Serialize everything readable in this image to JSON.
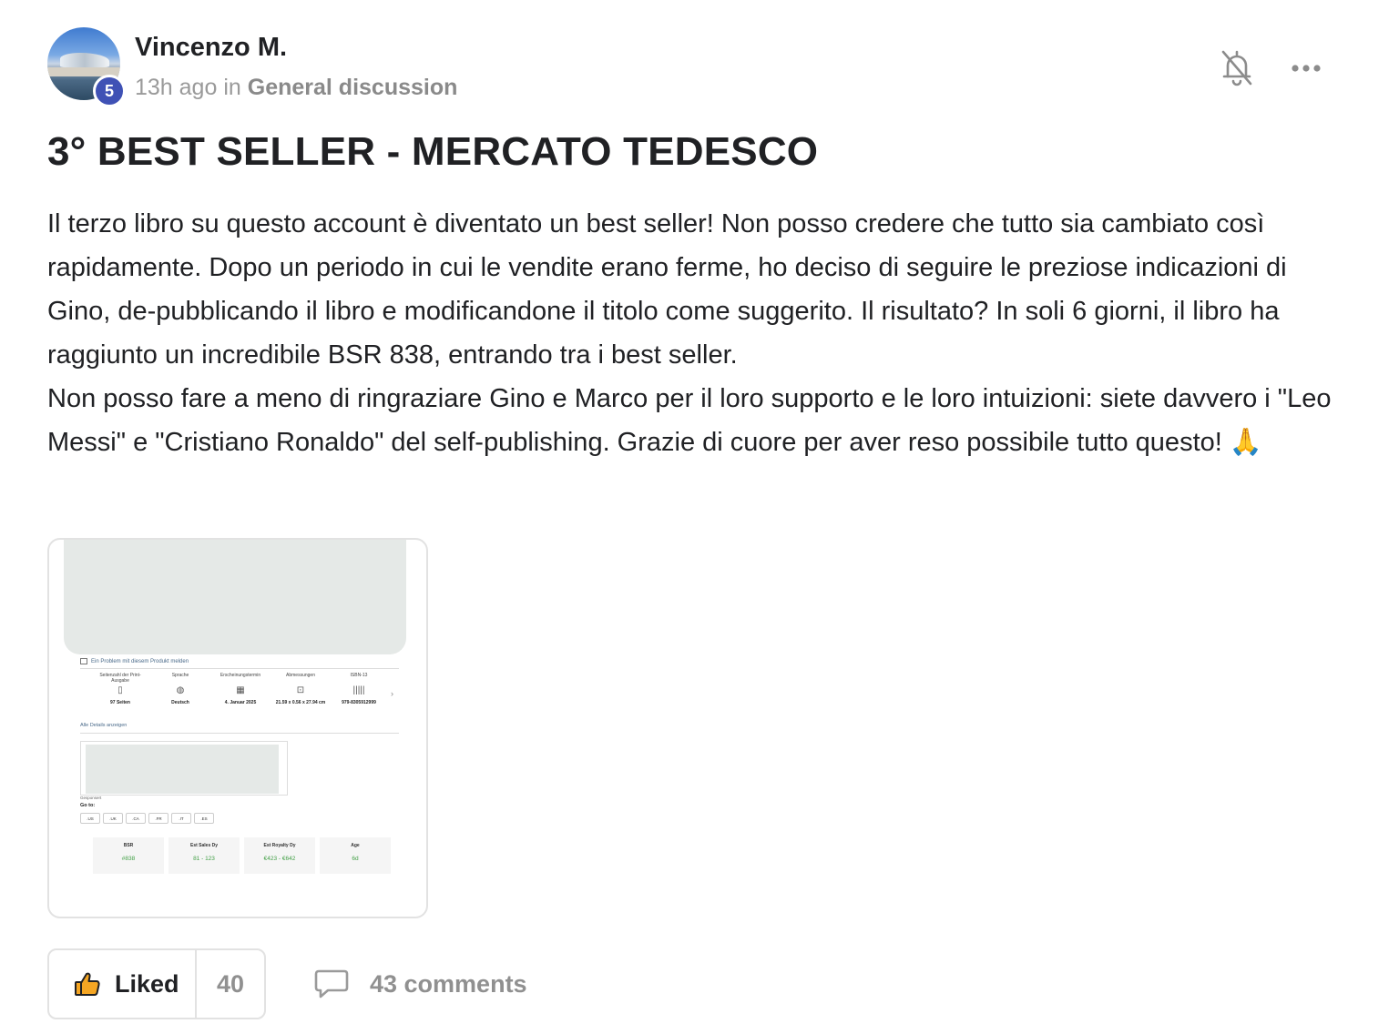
{
  "post": {
    "author": {
      "name": "Vincenzo M.",
      "level": "5",
      "avatar_icon": "avatar-photo"
    },
    "meta": {
      "time": "13h ago",
      "in_word": "in",
      "category": "General discussion"
    },
    "actions": {
      "notify_icon": "bell-off-icon",
      "more_icon": "ellipsis-icon"
    },
    "title": "3° BEST SELLER - MERCATO TEDESCO",
    "body": {
      "paragraph_1": "Il terzo libro su questo account è diventato un best seller! Non posso credere che tutto sia cambiato così rapidamente. Dopo un periodo in cui le vendite erano ferme, ho deciso di seguire le preziose indicazioni di Gino, de-pubblicando il libro e modificandone il titolo come suggerito. Il risultato? In soli 6 giorni, il libro ha raggiunto un incredibile BSR 838, entrando tra i best seller.",
      "paragraph_2": "Non posso fare a meno di ringraziare Gino e Marco per il loro supporto e le loro intuizioni: siete davvero i \"Leo Messi\" e \"Cristiano Ronaldo\" del self-publishing. Grazie di cuore per aver reso possibile tutto questo! 🙏"
    },
    "attachment": {
      "report_link": "Ein Problem mit diesem Produkt melden",
      "specs": [
        {
          "label": "Seitenzahl der Print-Ausgabe",
          "icon": "▯",
          "value": "97 Seiten"
        },
        {
          "label": "Sprache",
          "icon": "◍",
          "value": "Deutsch"
        },
        {
          "label": "Erscheinungstermin",
          "icon": "▦",
          "value": "4. Januar 2025"
        },
        {
          "label": "Abmessungen",
          "icon": "⊡",
          "value": "21.59 x 0.56 x 27.94 cm"
        },
        {
          "label": "ISBN-13",
          "icon": "|||||",
          "value": "979-8305912999"
        }
      ],
      "details_link": "Alle Details anzeigen",
      "sponsored": "Gesponsert",
      "goto_label": "Go to:",
      "markets": [
        ".US",
        ".UK",
        ".CA",
        ".FR",
        ".IT",
        ".ES"
      ],
      "stats": [
        {
          "key": "BSR",
          "value": "#838"
        },
        {
          "key": "Est Sales Dy",
          "value": "81 - 123"
        },
        {
          "key": "Est Royalty Dy",
          "value": "€423 - €642"
        },
        {
          "key": "Age",
          "value": "6d"
        }
      ]
    },
    "footer": {
      "like_icon": "thumbs-up-icon",
      "like_label": "Liked",
      "like_count": "40",
      "comment_icon": "comment-bubble-icon",
      "comments_label": "43 comments"
    }
  },
  "colors": {
    "badge": "#3f51b5",
    "like_accent": "#f5a623",
    "positive_green": "#43a047",
    "muted_text": "#909090"
  }
}
